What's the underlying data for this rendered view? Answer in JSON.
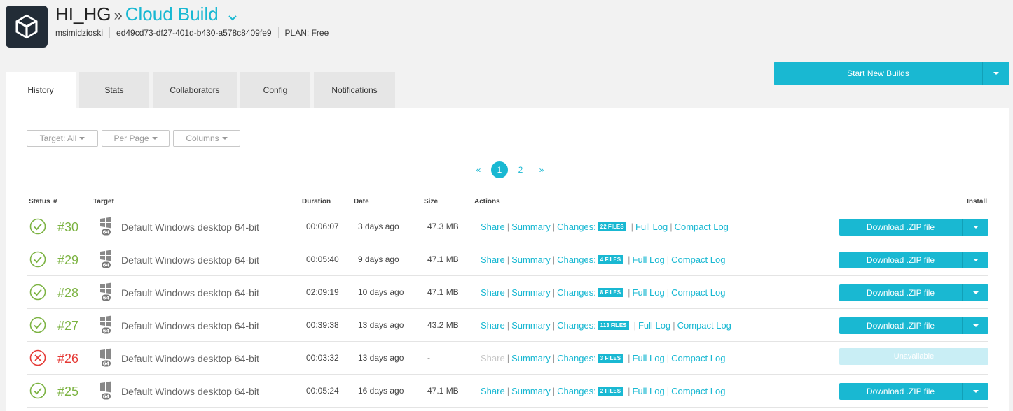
{
  "colors": {
    "accent": "#19b8d2",
    "success": "#7cb342",
    "failure": "#e53935"
  },
  "header": {
    "logo_icon": "unity-logo-icon",
    "org": "HI_HG",
    "separator": "»",
    "app": "Cloud Build",
    "user": "msimidzioski",
    "project_id": "ed49cd73-df27-401d-b430-a578c8409fe9",
    "plan": "PLAN: Free"
  },
  "start_button": {
    "label": "Start New Builds"
  },
  "tabs": [
    {
      "label": "History",
      "active": true
    },
    {
      "label": "Stats",
      "active": false
    },
    {
      "label": "Collaborators",
      "active": false
    },
    {
      "label": "Config",
      "active": false
    },
    {
      "label": "Notifications",
      "active": false
    }
  ],
  "filters": [
    {
      "label": "Target: All"
    },
    {
      "label": "Per Page"
    },
    {
      "label": "Columns"
    }
  ],
  "pagination": {
    "prev": "«",
    "pages": [
      "1",
      "2"
    ],
    "current": "1",
    "next": "»"
  },
  "table": {
    "headers": {
      "status": "Status",
      "num": "#",
      "target": "Target",
      "duration": "Duration",
      "date": "Date",
      "size": "Size",
      "actions": "Actions",
      "install": "Install"
    },
    "action_labels": {
      "share": "Share",
      "summary": "Summary",
      "changes": "Changes:",
      "full_log": "Full Log",
      "compact_log": "Compact Log",
      "download": "Download .ZIP file",
      "unavailable": "Unavailable"
    },
    "rows": [
      {
        "status": "success",
        "num": "#30",
        "target": "Default Windows desktop 64-bit",
        "platform_icon": "windows-64-icon",
        "duration": "00:06:07",
        "date": "3 days ago",
        "size": "47.3 MB",
        "files": "22 FILES",
        "available": true
      },
      {
        "status": "success",
        "num": "#29",
        "target": "Default Windows desktop 64-bit",
        "platform_icon": "windows-64-icon",
        "duration": "00:05:40",
        "date": "9 days ago",
        "size": "47.1 MB",
        "files": "4 FILES",
        "available": true
      },
      {
        "status": "success",
        "num": "#28",
        "target": "Default Windows desktop 64-bit",
        "platform_icon": "windows-64-icon",
        "duration": "02:09:19",
        "date": "10 days ago",
        "size": "47.1 MB",
        "files": "8 FILES",
        "available": true
      },
      {
        "status": "success",
        "num": "#27",
        "target": "Default Windows desktop 64-bit",
        "platform_icon": "windows-64-icon",
        "duration": "00:39:38",
        "date": "13 days ago",
        "size": "43.2 MB",
        "files": "113 FILES",
        "available": true
      },
      {
        "status": "failed",
        "num": "#26",
        "target": "Default Windows desktop 64-bit",
        "platform_icon": "windows-64-icon",
        "duration": "00:03:32",
        "date": "13 days ago",
        "size": "-",
        "files": "3 FILES",
        "available": false
      },
      {
        "status": "success",
        "num": "#25",
        "target": "Default Windows desktop 64-bit",
        "platform_icon": "windows-64-icon",
        "duration": "00:05:24",
        "date": "16 days ago",
        "size": "47.1 MB",
        "files": "2 FILES",
        "available": true
      }
    ]
  }
}
